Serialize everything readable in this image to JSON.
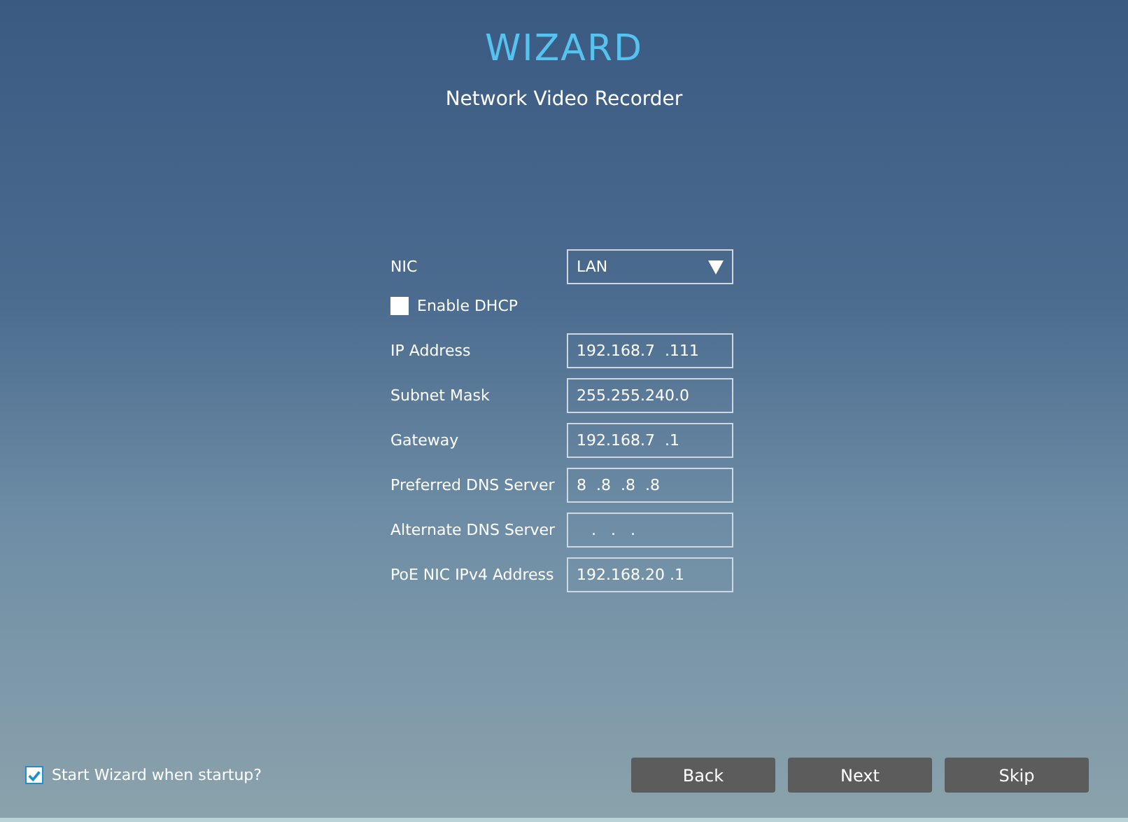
{
  "header": {
    "title": "WIZARD",
    "subtitle": "Network Video Recorder"
  },
  "form": [
    {
      "kind": "dropdown",
      "label": "NIC",
      "value": "LAN"
    },
    {
      "kind": "checkbox",
      "label": "Enable DHCP",
      "checked": false
    },
    {
      "kind": "text",
      "label": "IP Address",
      "value": "192.168.7  .111"
    },
    {
      "kind": "text",
      "label": "Subnet Mask",
      "value": "255.255.240.0"
    },
    {
      "kind": "text",
      "label": "Gateway",
      "value": "192.168.7  .1"
    },
    {
      "kind": "text",
      "label": "Preferred DNS Server",
      "value": "8  .8  .8  .8"
    },
    {
      "kind": "text",
      "label": "Alternate DNS Server",
      "value": "   .   .   ."
    },
    {
      "kind": "text",
      "label": "PoE NIC IPv4 Address",
      "value": "192.168.20 .1"
    }
  ],
  "footer": {
    "startup": {
      "label": "Start Wizard when startup?",
      "checked": true
    },
    "buttons": [
      "Back",
      "Next",
      "Skip"
    ]
  }
}
